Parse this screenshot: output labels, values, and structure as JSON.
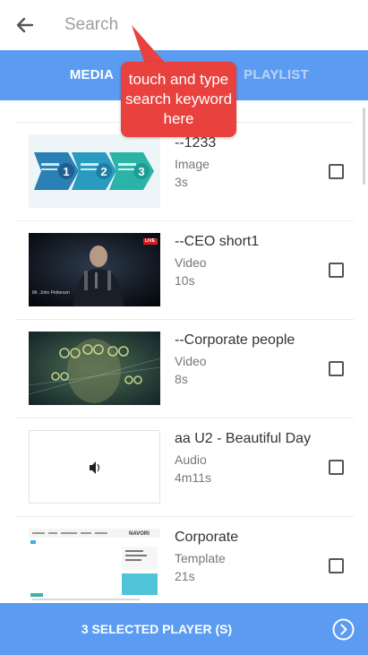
{
  "search": {
    "placeholder": "Search",
    "value": ""
  },
  "tabs": [
    {
      "label": "MEDIA",
      "active": true
    },
    {
      "label": "PLAYLIST",
      "active": false
    }
  ],
  "tooltip": {
    "text": "touch and type search keyword here"
  },
  "items": [
    {
      "title": "--1233",
      "type": "Image",
      "duration": "3s",
      "checked": false,
      "thumb": "steps-123-image"
    },
    {
      "title": "--CEO short1",
      "type": "Video",
      "duration": "10s",
      "checked": false,
      "thumb": "ceo-speaker-video",
      "thumb_caption": "Mr. John Petterson",
      "thumb_badge": "LIVE"
    },
    {
      "title": "--Corporate people",
      "type": "Video",
      "duration": "8s",
      "checked": false,
      "thumb": "corporate-people-video"
    },
    {
      "title": "aa U2 - Beautiful Day",
      "type": "Audio",
      "duration": "4m11s",
      "checked": false,
      "thumb": "speaker-icon"
    },
    {
      "title": "Corporate",
      "type": "Template",
      "duration": "21s",
      "checked": false,
      "thumb": "template-preview",
      "thumb_logo": "NAVORI"
    }
  ],
  "bottom_bar": {
    "label": "3 SELECTED PLAYER (S)"
  },
  "colors": {
    "primary": "#5b9cf2",
    "tooltip": "#e8413e",
    "tab_inactive": "#b9d3f8"
  }
}
